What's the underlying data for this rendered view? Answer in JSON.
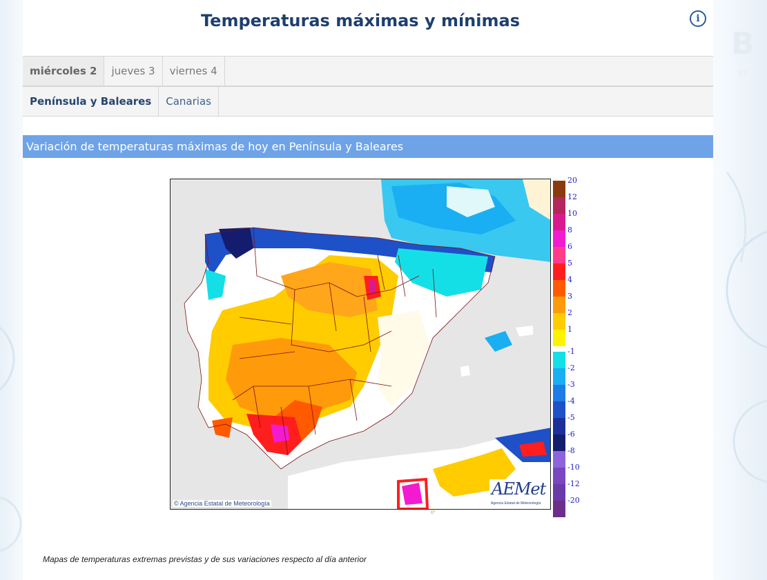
{
  "page": {
    "title": "Temperaturas máximas y mínimas",
    "info_icon": "info-icon"
  },
  "day_tabs": [
    {
      "label": "miércoles 2",
      "active": true
    },
    {
      "label": "jueves 3",
      "active": false
    },
    {
      "label": "viernes 4",
      "active": false
    }
  ],
  "region_tabs": [
    {
      "label": "Península y Baleares",
      "active": true
    },
    {
      "label": "Canarias",
      "active": false
    }
  ],
  "section": {
    "header": "Variación de temperaturas máximas de hoy en Península y Baleares"
  },
  "map": {
    "copyright": "Agencia Estatal de Meteorología",
    "logo_text": "AEMet",
    "logo_subtitle": "Agencia Estatal de Meteorología",
    "stray_label": "0°"
  },
  "legend": {
    "positive": [
      {
        "label": "20",
        "color": "#8b3a0f"
      },
      {
        "label": "12",
        "color": "#b5265a"
      },
      {
        "label": "10",
        "color": "#d81b8c"
      },
      {
        "label": "8",
        "color": "#f21bd0"
      },
      {
        "label": "6",
        "color": "#ff3c8c"
      },
      {
        "label": "5",
        "color": "#ff1e1e"
      },
      {
        "label": "4",
        "color": "#ff5a00"
      },
      {
        "label": "3",
        "color": "#ff9a0a"
      },
      {
        "label": "2",
        "color": "#ffcc00"
      },
      {
        "label": "1",
        "color": "#fff200"
      }
    ],
    "negative": [
      {
        "label": "-1",
        "color": "#15dfe6"
      },
      {
        "label": "-2",
        "color": "#1aaef2"
      },
      {
        "label": "-3",
        "color": "#1e7ce6"
      },
      {
        "label": "-4",
        "color": "#1e50c8"
      },
      {
        "label": "-5",
        "color": "#1c2f9a"
      },
      {
        "label": "-6",
        "color": "#141c6e"
      },
      {
        "label": "-8",
        "color": "#8c64dc"
      },
      {
        "label": "-10",
        "color": "#7a46c0"
      },
      {
        "label": "-12",
        "color": "#6a3aa8"
      },
      {
        "label": "-20",
        "color": "#6b2f8a"
      }
    ]
  },
  "caption": "Mapas de temperaturas extremas previstas y de sus variaciones respecto al día anterior"
}
